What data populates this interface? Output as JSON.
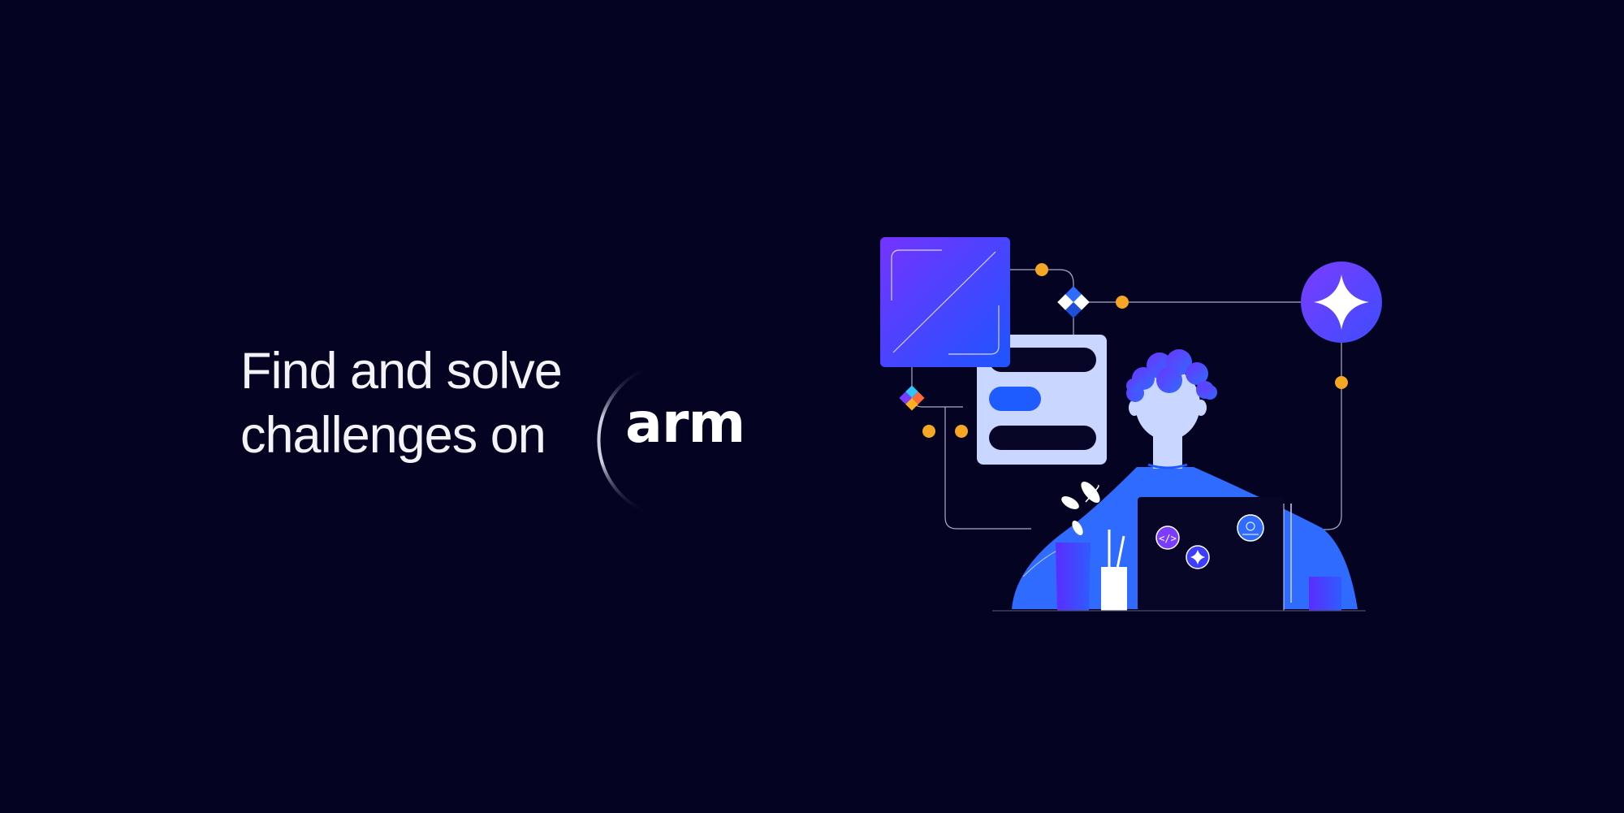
{
  "banner": {
    "headline_line1": "Find and solve",
    "headline_line2": "challenges on",
    "logo_text": "arm"
  },
  "colors": {
    "background": "#050322",
    "accent_blue": "#1f5cff",
    "accent_purple": "#6a35ff",
    "connector_dot": "#f5a623",
    "panel_light": "#c9d6ff"
  },
  "icons": [
    "sparkle-icon",
    "code-icon",
    "diamond-icon"
  ]
}
